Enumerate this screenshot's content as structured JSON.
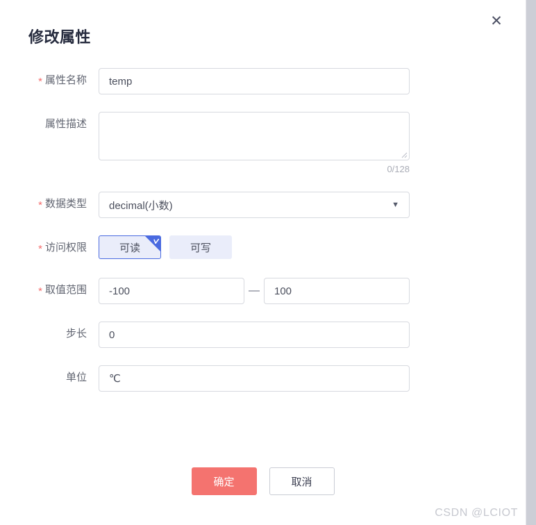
{
  "dialog": {
    "title": "修改属性",
    "close_icon": "close-icon"
  },
  "fields": {
    "name": {
      "label": "属性名称",
      "required": true,
      "value": "temp",
      "placeholder": ""
    },
    "description": {
      "label": "属性描述",
      "required": false,
      "value": "",
      "placeholder": "",
      "counter": "0/128"
    },
    "data_type": {
      "label": "数据类型",
      "required": true,
      "value": "decimal(小数)",
      "caret_icon": "chevron-down-icon"
    },
    "access": {
      "label": "访问权限",
      "required": true,
      "options": [
        {
          "label": "可读",
          "selected": true
        },
        {
          "label": "可写",
          "selected": false
        }
      ]
    },
    "value_range": {
      "label": "取值范围",
      "required": true,
      "min": "-100",
      "max": "100",
      "separator": "—"
    },
    "step": {
      "label": "步长",
      "required": false,
      "value": "0",
      "placeholder": ""
    },
    "unit": {
      "label": "单位",
      "required": false,
      "value": "℃",
      "placeholder": ""
    }
  },
  "footer": {
    "confirm_label": "确定",
    "cancel_label": "取消"
  },
  "watermark": "CSDN @LCIOT",
  "colors": {
    "primary_button": "#f4736f",
    "required_star": "#f46b6b",
    "chip_selected_border": "#4a6ae0",
    "chip_background": "#eaedfa",
    "input_border": "#d7d9df"
  },
  "symbols": {
    "star": "*",
    "close": "✕",
    "caret": "▼"
  }
}
